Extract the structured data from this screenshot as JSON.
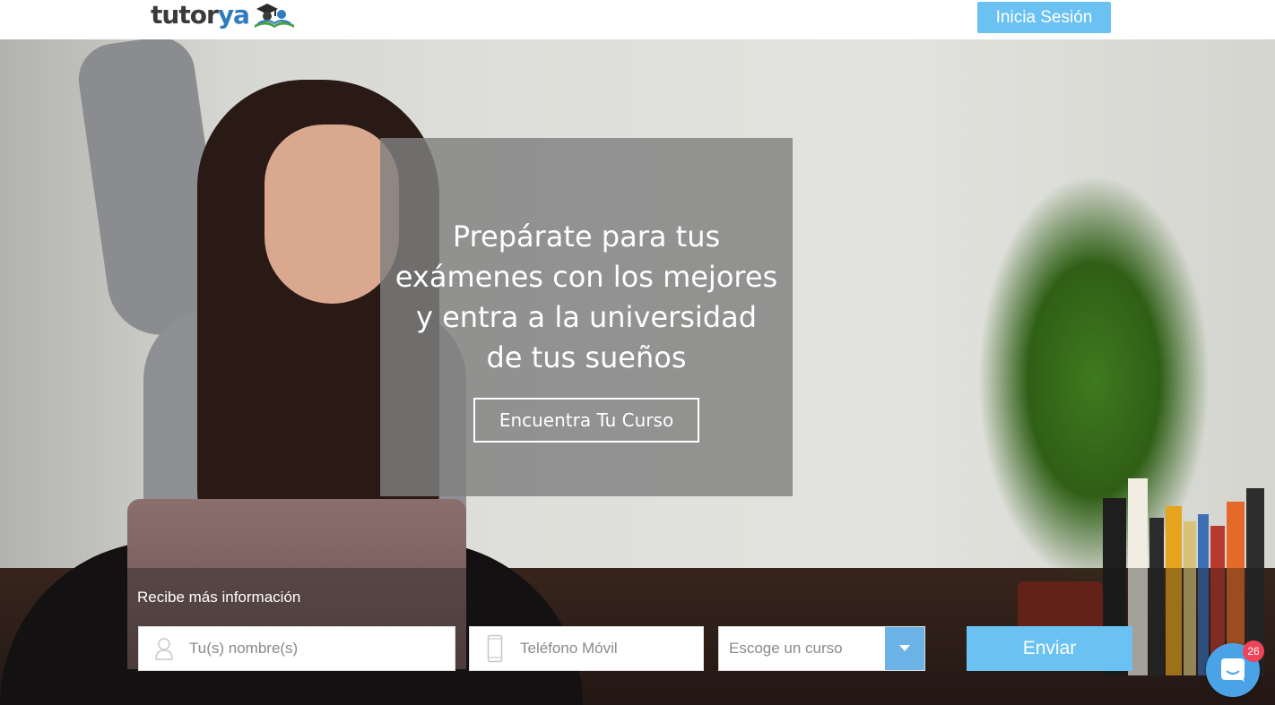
{
  "header": {
    "logo_main": "tutor",
    "logo_accent": "ya",
    "login_label": "Inicia Sesión"
  },
  "hero": {
    "headline_lines": [
      "Prepárate para tus",
      "exámenes con los mejores",
      "y entra a la universidad",
      "de tus sueños"
    ],
    "cta_label": "Encuentra Tu Curso"
  },
  "form": {
    "title": "Recibe más información",
    "name_placeholder": "Tu(s) nombre(s)",
    "phone_placeholder": "Teléfono Móvil",
    "course_placeholder": "Escoge un curso",
    "submit_label": "Enviar"
  },
  "chat": {
    "badge_count": "26"
  },
  "colors": {
    "accent": "#6bc1f1",
    "logo_blue": "#2e7bbf",
    "chat": "#4aa3e6",
    "badge": "#f0445a"
  },
  "icons": {
    "user": "user-icon",
    "phone": "phone-icon",
    "dropdown": "caret-down-icon",
    "chat": "chat-icon",
    "logo": "graduation-cap-icon"
  }
}
